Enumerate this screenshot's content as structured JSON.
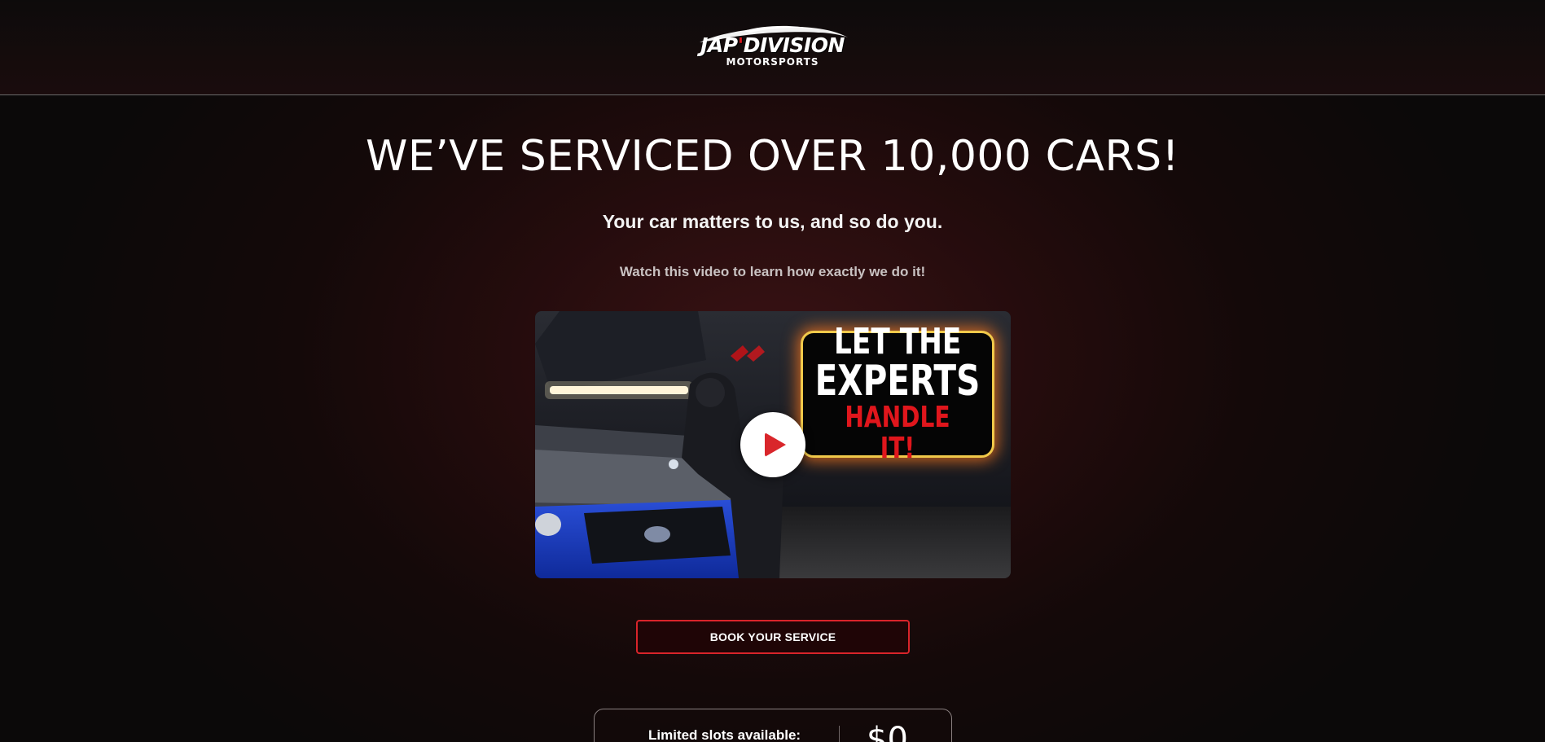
{
  "header": {
    "logo": {
      "brand_prefix": "JAP",
      "brand_suffix": "DIVISION",
      "tagline": "MOTORSPORTS"
    }
  },
  "hero": {
    "headline": "WE’VE SERVICED OVER 10,000 CARS!",
    "subheadline": "Your car matters to us, and so do you.",
    "instruction": "Watch this video to learn how exactly we do it!"
  },
  "video": {
    "thumbnail_text": {
      "line1": "LET THE",
      "line2": "EXPERTS",
      "line3": "HANDLE IT!"
    },
    "play_icon": "play-icon"
  },
  "cta": {
    "label": "BOOK YOUR SERVICE"
  },
  "offer": {
    "label": "Limited slots available:",
    "price": "$0"
  },
  "colors": {
    "accent_red": "#d8242a",
    "highlight_gold": "#f1c94a",
    "background": "#0b0909"
  }
}
